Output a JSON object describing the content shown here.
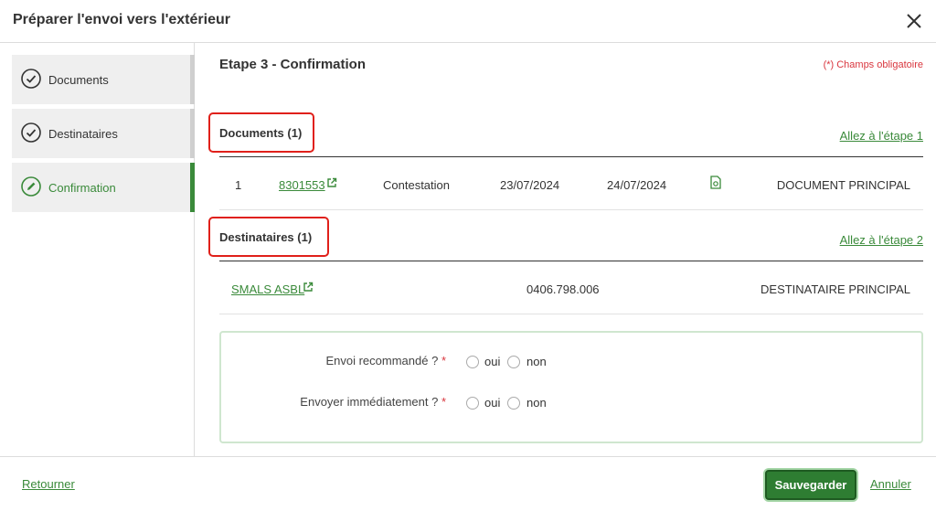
{
  "dialog": {
    "title": "Préparer l'envoi vers l'extérieur"
  },
  "sidebar": {
    "steps": [
      {
        "label": "Documents",
        "state": "done"
      },
      {
        "label": "Destinataires",
        "state": "done"
      },
      {
        "label": "Confirmation",
        "state": "active"
      }
    ]
  },
  "main": {
    "step_title": "Etape 3 - Confirmation",
    "required_note": "(*) Champs obligatoire",
    "documents": {
      "title": "Documents (1)",
      "goto_link": "Allez à l'étape 1",
      "rows": [
        {
          "index": "1",
          "reference": "8301553",
          "type": "Contestation",
          "date1": "23/07/2024",
          "date2": "24/07/2024",
          "icon": "document-icon",
          "role": "DOCUMENT PRINCIPAL"
        }
      ]
    },
    "recipients": {
      "title": "Destinataires (1)",
      "goto_link": "Allez à l'étape 2",
      "rows": [
        {
          "name": "SMALS ASBL",
          "number": "0406.798.006",
          "role": "DESTINATAIRE PRINCIPAL"
        }
      ]
    },
    "options": [
      {
        "label": "Envoi recommandé ?",
        "required": "*",
        "yes": "oui",
        "no": "non"
      },
      {
        "label": "Envoyer immédiatement ?",
        "required": "*",
        "yes": "oui",
        "no": "non"
      }
    ]
  },
  "footer": {
    "back": "Retourner",
    "save": "Sauvegarder",
    "cancel": "Annuler"
  },
  "colors": {
    "accent": "#3a8a3a",
    "required": "#d9363e",
    "highlight": "#e0201a",
    "primary_button": "#2e7d32"
  }
}
